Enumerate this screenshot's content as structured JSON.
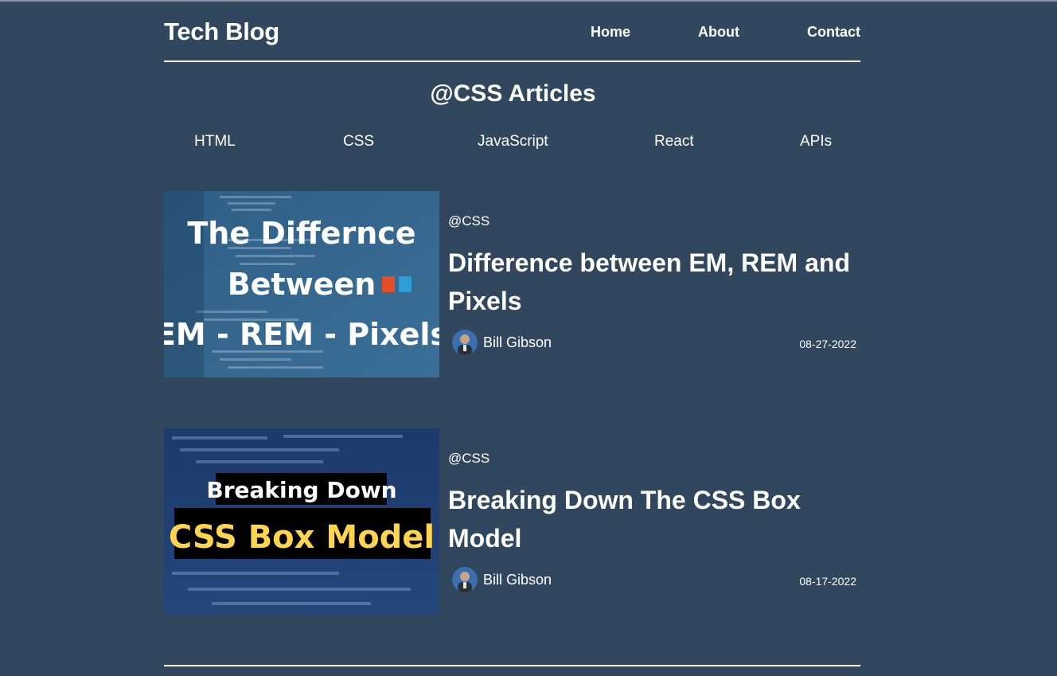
{
  "header": {
    "brand": "Tech Blog",
    "nav": [
      "Home",
      "About",
      "Contact"
    ]
  },
  "section": {
    "title": "@CSS Articles"
  },
  "categories": [
    "HTML",
    "CSS",
    "JavaScript",
    "React",
    "APIs"
  ],
  "articles": [
    {
      "thumb_text": [
        "The Differnce",
        "Between",
        "EM - REM - Pixels"
      ],
      "tag": "@CSS",
      "title": "Difference between EM, REM and Pixels",
      "author": "Bill Gibson",
      "date": "08-27-2022"
    },
    {
      "thumb_text": [
        "Breaking Down",
        "CSS Box Model"
      ],
      "tag": "@CSS",
      "title": "Breaking Down The CSS Box Model",
      "author": "Bill Gibson",
      "date": "08-17-2022"
    }
  ],
  "colors": {
    "background": "#30475e",
    "text": "#ffffff",
    "thumb_highlight": "#ffd54f"
  }
}
